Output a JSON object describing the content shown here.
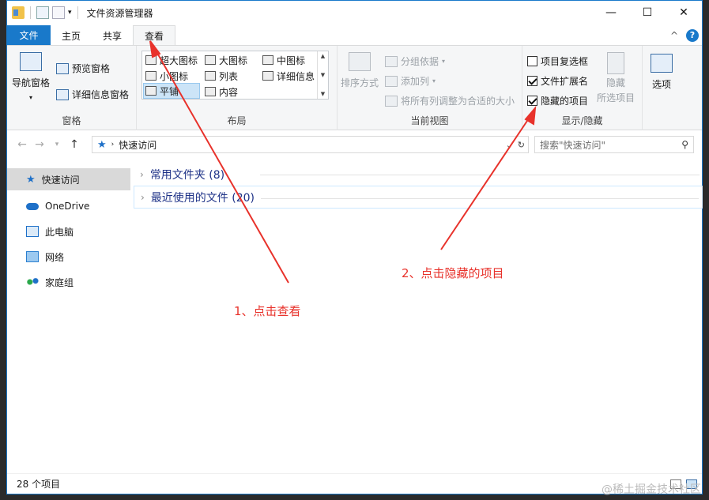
{
  "titlebar": {
    "title": "文件资源管理器",
    "minimize": "—",
    "maximize": "☐",
    "close": "✕"
  },
  "tabs": {
    "file": "文件",
    "home": "主页",
    "share": "共享",
    "view": "查看",
    "collapse": "^",
    "help": "?"
  },
  "ribbon": {
    "panes": {
      "label": "窗格",
      "nav_pane": "导航窗格",
      "preview": "预览窗格",
      "details": "详细信息窗格"
    },
    "layout": {
      "label": "布局",
      "items": [
        "超大图标",
        "大图标",
        "中图标",
        "小图标",
        "列表",
        "详细信息",
        "平铺",
        "内容"
      ]
    },
    "current_view": {
      "label": "当前视图",
      "sort": "排序方式",
      "group_by": "分组依据",
      "add_column": "添加列",
      "fit_columns": "将所有列调整为合适的大小"
    },
    "show_hide": {
      "label": "显示/隐藏",
      "item_checkbox": "项目复选框",
      "item_checkbox_checked": false,
      "file_ext": "文件扩展名",
      "file_ext_checked": true,
      "hidden_items": "隐藏的项目",
      "hidden_items_checked": true,
      "hide_selected_1": "隐藏",
      "hide_selected_2": "所选项目"
    },
    "options": "选项"
  },
  "addressbar": {
    "path": "快速访问",
    "search_placeholder": "搜索\"快速访问\""
  },
  "nav": [
    "快速访问",
    "OneDrive",
    "此电脑",
    "网络",
    "家庭组"
  ],
  "content": {
    "folders": "常用文件夹 (8)",
    "recent": "最近使用的文件 (20)"
  },
  "status": {
    "count": "28 个项目"
  },
  "annotations": {
    "step1": "1、点击查看",
    "step2": "2、点击隐藏的项目",
    "color": "#e8322b"
  },
  "watermark": "@稀土掘金技术社区"
}
